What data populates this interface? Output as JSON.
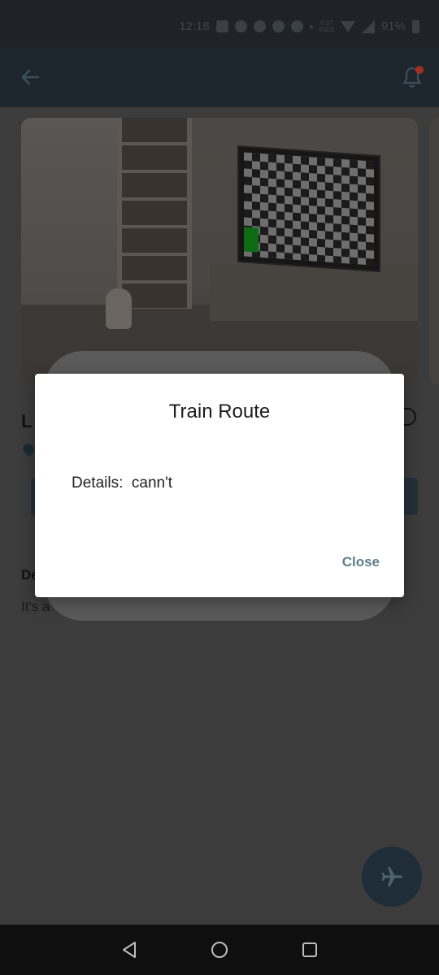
{
  "status_bar": {
    "time": "12:18",
    "net_speed": "0.07",
    "net_unit": "KB/S",
    "battery": "91%"
  },
  "app_bar": {
    "back_icon": "arrow-left-icon",
    "bell_icon": "bell-icon",
    "notification_dot": true
  },
  "content": {
    "title_fragment": "L",
    "description_heading_fragment": "De",
    "description_text_fragment": "It's a"
  },
  "dialog": {
    "title": "Train Route",
    "details": "Details:  cann't",
    "close_label": "Close"
  },
  "fab": {
    "icon": "airplane-icon"
  },
  "nav_bar": {
    "icons": [
      "back-triangle-icon",
      "home-circle-icon",
      "recents-square-icon"
    ]
  },
  "colors": {
    "app_bar": "#1e262d",
    "scrim": "#3c3c3c",
    "accent": "#607d8b",
    "fab": "#1e2d38",
    "notification": "#a03020"
  }
}
